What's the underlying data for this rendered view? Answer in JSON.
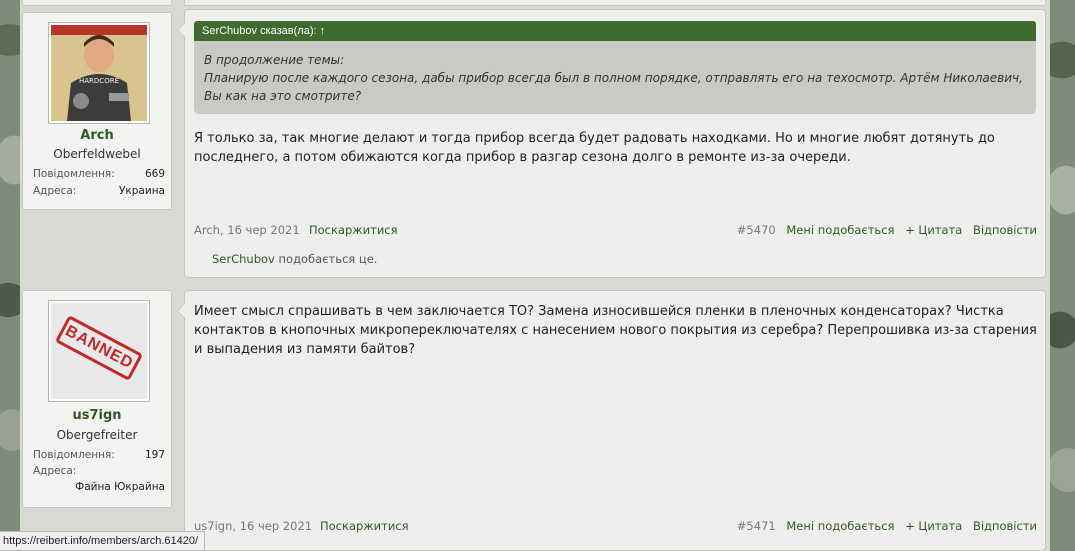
{
  "posts": [
    {
      "username": "Arch",
      "rank": "Oberfeldwebel",
      "stats": [
        {
          "label": "Повідомлення:",
          "value": "669"
        },
        {
          "label": "Адреса:",
          "value": "Украина"
        }
      ],
      "avatar_icon": "poster-avatar",
      "avatar_text": "HARDCORE",
      "quote": {
        "header": "SerChubov сказав(ла): ↑",
        "lines": [
          "В продолжение темы:",
          "Планирую после каждого сезона, дабы прибор всегда был в полном порядке, отправлять его на техосмотр. Артём Николаевич,",
          "Вы как на это смотрите?"
        ]
      },
      "body": [
        "Я только за, так многие делают и тогда прибор всегда будет радовать находками. Но и многие любят дотянуть до",
        "последнего, а потом обижаются когда прибор в разгар сезона долго в ремонте из-за очереди."
      ],
      "author_date": "Arch, 16 чер 2021",
      "report": "Поскаржитися",
      "number": "#5470",
      "like": "Мені подобається",
      "quote_action": "+ Цитата",
      "reply": "Відповісти",
      "liked_by": "SerChubov",
      "liked_suffix": "подобається це."
    },
    {
      "username": "us7ign",
      "rank": "Obergefreiter",
      "stats": [
        {
          "label": "Повідомлення:",
          "value": "197"
        },
        {
          "label": "Адреса:",
          "value": ""
        },
        {
          "label": "",
          "value": "Файна Юкрайна"
        }
      ],
      "avatar_icon": "banned-stamp-avatar",
      "avatar_text": "BANNED",
      "body": [
        "Имеет смысл спрашивать в чем заключается ТО? Замена износившейся пленки в пленочных конденсаторах? Чистка",
        "контактов в кнопочных микропереключателях с нанесением нового покрытия из серебра? Перепрошивка из-за старения",
        "и выпадения из памяти байтов?"
      ],
      "author_date": "us7ign, 16 чер 2021",
      "report": "Поскаржитися",
      "number": "#5471",
      "like": "Мені подобається",
      "quote_action": "+ Цитата",
      "reply": "Відповісти"
    }
  ],
  "status_bar": "https://reibert.info/members/arch.61420/"
}
